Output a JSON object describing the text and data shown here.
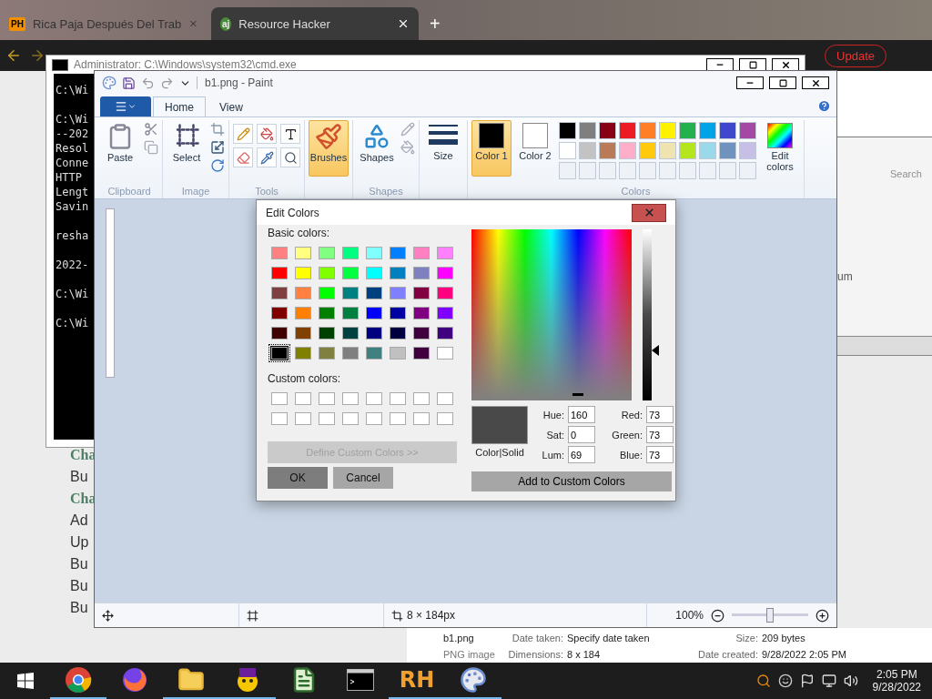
{
  "browser": {
    "tabs": [
      {
        "favicon": "PH",
        "label": "Rica Paja Después Del Trab",
        "selected": false
      },
      {
        "favicon": "aj",
        "label": "Resource Hacker",
        "selected": true
      }
    ],
    "new_tab": "+",
    "update_button": "Update",
    "page_lines": [
      {
        "kind": "heading",
        "text": "Cha"
      },
      {
        "kind": "item",
        "text": "Bu"
      },
      {
        "kind": "heading",
        "text": "Cha"
      },
      {
        "kind": "item",
        "text": "Ad"
      },
      {
        "kind": "item",
        "text": "Up"
      },
      {
        "kind": "item",
        "text": "Bu"
      },
      {
        "kind": "item",
        "text": "Bu"
      },
      {
        "kind": "item",
        "text": "Bu"
      }
    ],
    "search_placeholder": "Search",
    "side_fragment": "um",
    "details": {
      "name": "b1.png",
      "type": "PNG image",
      "fields": [
        {
          "label": "Date taken:",
          "value": "Specify date taken"
        },
        {
          "label": "Size:",
          "value": "209 bytes"
        },
        {
          "label": "Dimensions:",
          "value": "8 x 184"
        },
        {
          "label": "Date created:",
          "value": "9/28/2022 2:05 PM"
        }
      ]
    }
  },
  "cmd": {
    "title": "Administrator: C:\\Windows\\system32\\cmd.exe",
    "blocks": [
      [
        "C:\\Wi"
      ],
      [
        "C:\\Wi",
        "--202",
        "Resol",
        "Conne",
        "HTTP",
        "Lengt",
        "Savin"
      ],
      [
        "resha"
      ],
      [
        "2022-"
      ],
      [
        "C:\\Wi"
      ],
      [
        "C:\\Wi"
      ]
    ]
  },
  "paint": {
    "title": "b1.png - Paint",
    "tabs": [
      {
        "label": "Home",
        "selected": true
      },
      {
        "label": "View",
        "selected": false
      }
    ],
    "ribbon": {
      "paste": "Paste",
      "clipboard_label": "Clipboard",
      "select": "Select",
      "image_label": "Image",
      "tools_label": "Tools",
      "brushes": {
        "label": "Brushes",
        "selected": true
      },
      "shapes": "Shapes",
      "shapes_label": "Shapes",
      "size": "Size",
      "color1": {
        "label": "Color 1",
        "selected": true
      },
      "color2": {
        "label": "Color 2",
        "selected": false
      },
      "palette": [
        {
          "color": "#000000"
        },
        {
          "color": "#7f7f7f"
        },
        {
          "color": "#880015"
        },
        {
          "color": "#ed1c24"
        },
        {
          "color": "#ff7f27"
        },
        {
          "color": "#fff200"
        },
        {
          "color": "#22b14c"
        },
        {
          "color": "#00a2e8"
        },
        {
          "color": "#3f48cc"
        },
        {
          "color": "#a349a4"
        },
        {
          "color": "#ffffff"
        },
        {
          "color": "#c3c3c3"
        },
        {
          "color": "#b97a57"
        },
        {
          "color": "#ffaec9"
        },
        {
          "color": "#ffc90e"
        },
        {
          "color": "#efe4b0"
        },
        {
          "color": "#b5e61d"
        },
        {
          "color": "#99d9ea"
        },
        {
          "color": "#7092be"
        },
        {
          "color": "#c8bfe7"
        }
      ],
      "colors_label": "Colors",
      "edit_colors": "Edit colors"
    },
    "status": {
      "size": "8 × 184px",
      "zoom": "100%",
      "zoom_slider": {
        "level": 0.5
      }
    }
  },
  "dialog": {
    "title": "Edit Colors",
    "basic_label": "Basic colors:",
    "basic_colors": [
      {
        "color": "#ff8080",
        "selected": false
      },
      {
        "color": "#ffff80",
        "selected": false
      },
      {
        "color": "#80ff80",
        "selected": false
      },
      {
        "color": "#00ff80",
        "selected": false
      },
      {
        "color": "#80ffff",
        "selected": false
      },
      {
        "color": "#0080ff",
        "selected": false
      },
      {
        "color": "#ff80c0",
        "selected": false
      },
      {
        "color": "#ff80ff",
        "selected": false
      },
      {
        "color": "#ff0000",
        "selected": false
      },
      {
        "color": "#ffff00",
        "selected": false
      },
      {
        "color": "#80ff00",
        "selected": false
      },
      {
        "color": "#00ff40",
        "selected": false
      },
      {
        "color": "#00ffff",
        "selected": false
      },
      {
        "color": "#0080c0",
        "selected": false
      },
      {
        "color": "#8080c0",
        "selected": false
      },
      {
        "color": "#ff00ff",
        "selected": false
      },
      {
        "color": "#804040",
        "selected": false
      },
      {
        "color": "#ff8040",
        "selected": false
      },
      {
        "color": "#00ff00",
        "selected": false
      },
      {
        "color": "#008080",
        "selected": false
      },
      {
        "color": "#004080",
        "selected": false
      },
      {
        "color": "#8080ff",
        "selected": false
      },
      {
        "color": "#800040",
        "selected": false
      },
      {
        "color": "#ff0080",
        "selected": false
      },
      {
        "color": "#800000",
        "selected": false
      },
      {
        "color": "#ff8000",
        "selected": false
      },
      {
        "color": "#008000",
        "selected": false
      },
      {
        "color": "#008040",
        "selected": false
      },
      {
        "color": "#0000ff",
        "selected": false
      },
      {
        "color": "#0000a0",
        "selected": false
      },
      {
        "color": "#800080",
        "selected": false
      },
      {
        "color": "#8000ff",
        "selected": false
      },
      {
        "color": "#400000",
        "selected": false
      },
      {
        "color": "#804000",
        "selected": false
      },
      {
        "color": "#004000",
        "selected": false
      },
      {
        "color": "#004040",
        "selected": false
      },
      {
        "color": "#000080",
        "selected": false
      },
      {
        "color": "#000040",
        "selected": false
      },
      {
        "color": "#400040",
        "selected": false
      },
      {
        "color": "#400080",
        "selected": false
      },
      {
        "color": "#000000",
        "selected": true
      },
      {
        "color": "#808000",
        "selected": false
      },
      {
        "color": "#808040",
        "selected": false
      },
      {
        "color": "#808080",
        "selected": false
      },
      {
        "color": "#408080",
        "selected": false
      },
      {
        "color": "#c0c0c0",
        "selected": false
      },
      {
        "color": "#400040",
        "selected": false
      },
      {
        "color": "#ffffff",
        "selected": false
      }
    ],
    "custom_label": "Custom colors:",
    "define_button": {
      "label": "Define Custom Colors >>",
      "disabled": true
    },
    "ok": "OK",
    "cancel": "Cancel",
    "preview_label": "Color|Solid",
    "lum_slider": {
      "level": 0.29
    },
    "fields": [
      {
        "label": "Hue:",
        "value": "160"
      },
      {
        "label": "Red:",
        "value": "73"
      },
      {
        "label": "Sat:",
        "value": "0"
      },
      {
        "label": "Green:",
        "value": "73"
      },
      {
        "label": "Lum:",
        "value": "69"
      },
      {
        "label": "Blue:",
        "value": "73"
      }
    ],
    "add_button": "Add to Custom Colors"
  },
  "taskbar": {
    "apps": [
      {
        "kind": "chrome",
        "running": true
      },
      {
        "kind": "firefox",
        "running": false
      },
      {
        "kind": "folder",
        "running": true
      },
      {
        "kind": "yahoo",
        "running": true
      },
      {
        "kind": "notepad",
        "running": false
      },
      {
        "kind": "cmd",
        "running": false
      },
      {
        "kind": "rh",
        "label": "RH",
        "running": true
      },
      {
        "kind": "paint",
        "running": true
      }
    ],
    "time": "2:05 PM",
    "date": "9/28/2022"
  }
}
